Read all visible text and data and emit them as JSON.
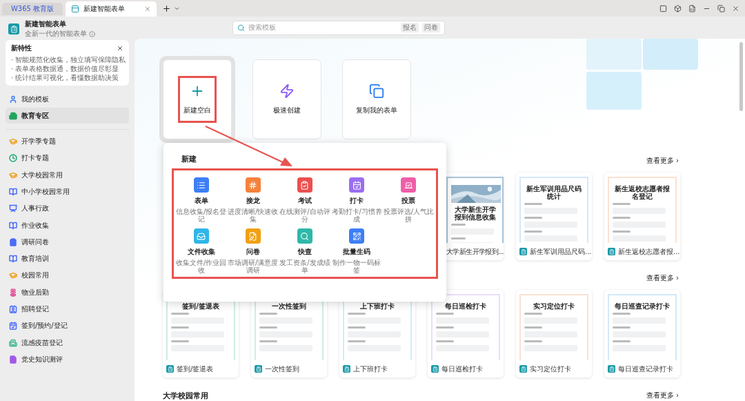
{
  "tabs": [
    {
      "label": "W365 教育版",
      "selected": false
    },
    {
      "label": "新建智能表单",
      "selected": true
    }
  ],
  "app": {
    "title": "新建智能表单",
    "subtitle": "全新一代的智能表单"
  },
  "search": {
    "placeholder": "搜索模板",
    "tags": [
      "报名",
      "问卷"
    ]
  },
  "features": {
    "title": "新特性",
    "lines": [
      "· 智能规范化收集，独立填写保障隐私",
      "· 表单表格数据通，数据价值尽彰显",
      "· 统计结果可视化，看懂数据助决策"
    ]
  },
  "sidebar": {
    "items": [
      {
        "label": "我的模板",
        "kind": "user",
        "color": "#3b7cf5",
        "selected": false
      },
      {
        "label": "教育专区",
        "kind": "building",
        "color": "#22a45d",
        "selected": true
      },
      {
        "label": "开学季专题",
        "kind": "cap",
        "color": "#f0a020",
        "selected": false
      },
      {
        "label": "打卡专题",
        "kind": "clock",
        "color": "#1fa971",
        "selected": false
      },
      {
        "label": "大学校园常用",
        "kind": "cap",
        "color": "#f0a020",
        "selected": false
      },
      {
        "label": "中小学校园常用",
        "kind": "book",
        "color": "#4a6cf7",
        "selected": false
      },
      {
        "label": "人事行政",
        "kind": "monitor",
        "color": "#4a6cf7",
        "selected": false
      },
      {
        "label": "作业收集",
        "kind": "book",
        "color": "#4a6cf7",
        "selected": false
      },
      {
        "label": "调研问卷",
        "kind": "clipboard",
        "color": "#4a6cf7",
        "selected": false
      },
      {
        "label": "教育培训",
        "kind": "book",
        "color": "#4a6cf7",
        "selected": false
      },
      {
        "label": "校园常用",
        "kind": "cap",
        "color": "#f0a020",
        "selected": false
      },
      {
        "label": "物业后勤",
        "kind": "flower",
        "color": "#e0559a",
        "selected": false
      },
      {
        "label": "招聘登记",
        "kind": "idcard",
        "color": "#4a6cf7",
        "selected": false
      },
      {
        "label": "签到/预约/登记",
        "kind": "calendar",
        "color": "#4a6cf7",
        "selected": false
      },
      {
        "label": "流感疫苗登记",
        "kind": "hospital",
        "color": "#3cb88a",
        "selected": false
      },
      {
        "label": "党史知识测评",
        "kind": "file",
        "color": "#a259e6",
        "selected": false
      }
    ]
  },
  "actions": [
    {
      "label": "新建空白",
      "kind": "plus",
      "selected": true
    },
    {
      "label": "极速创建",
      "kind": "zap",
      "selected": false
    },
    {
      "label": "复制我的表单",
      "kind": "copy",
      "selected": false
    }
  ],
  "popup": {
    "title": "新建",
    "items": [
      {
        "name": "表单",
        "desc": "信息收集/报名登记",
        "kind": "list",
        "color": "#3d7ef6"
      },
      {
        "name": "接龙",
        "desc": "进度清晰/快速收集",
        "kind": "hash",
        "color": "#f5813a"
      },
      {
        "name": "考试",
        "desc": "在线测评/自动评分",
        "kind": "exam",
        "color": "#ec4f4f"
      },
      {
        "name": "打卡",
        "desc": "考勤打卡/习惯养成",
        "kind": "calendar",
        "color": "#9a6ef0"
      },
      {
        "name": "投票",
        "desc": "投票评选/人气比拼",
        "kind": "vote",
        "color": "#ef5fa7"
      },
      {
        "name": "文件收集",
        "desc": "收集文件/作业回收",
        "kind": "inbox",
        "color": "#2fb6e6"
      },
      {
        "name": "问卷",
        "desc": "市场调研/满意度调研",
        "kind": "pen",
        "color": "#f0a012"
      },
      {
        "name": "快查",
        "desc": "发工资条/发成绩单",
        "kind": "search",
        "color": "#2fb8a8"
      },
      {
        "name": "批量生码",
        "desc": "制作一物一码标签",
        "kind": "qr",
        "color": "#3d7ef6"
      }
    ]
  },
  "sections": [
    {
      "more": "查看更多 ›",
      "cards": [
        {
          "title": "大学新生开学报到...",
          "preview_title": "大学新生开学报到信息收集",
          "color": "#a9c3d9"
        },
        {
          "title": "新生军训用品尺码...",
          "preview_title": "新生军训用品尺码统计",
          "kind": "form",
          "color": "#d3e8fb"
        },
        {
          "title": "新生返校志愿者报...",
          "preview_title": "新生返校志愿者报名登记",
          "kind": "form",
          "color": "#fbe1d2"
        }
      ]
    },
    {
      "more": "查看更多 ›",
      "cards": [
        {
          "title": "签到/签退表",
          "preview_title": "签到/签退表",
          "kind": "form",
          "color": "#cdeee2"
        },
        {
          "title": "一次性签到",
          "preview_title": "一次性签到",
          "kind": "form",
          "color": "#cdeee2"
        },
        {
          "title": "上下班打卡",
          "preview_title": "上下班打卡",
          "kind": "form",
          "color": "#d3ebf5"
        },
        {
          "title": "每日巡检打卡",
          "preview_title": "每日巡检打卡",
          "kind": "form",
          "color": "#e9defa"
        },
        {
          "title": "实习定位打卡",
          "preview_title": "实习定位打卡",
          "kind": "form",
          "color": "#fbe1d2"
        },
        {
          "title": "每日巡查记录打卡",
          "preview_title": "每日巡查记录打卡",
          "kind": "form",
          "color": "#d3e8fb"
        }
      ]
    },
    {
      "heading": "大学校园常用",
      "more": "查看更多 ›"
    }
  ]
}
